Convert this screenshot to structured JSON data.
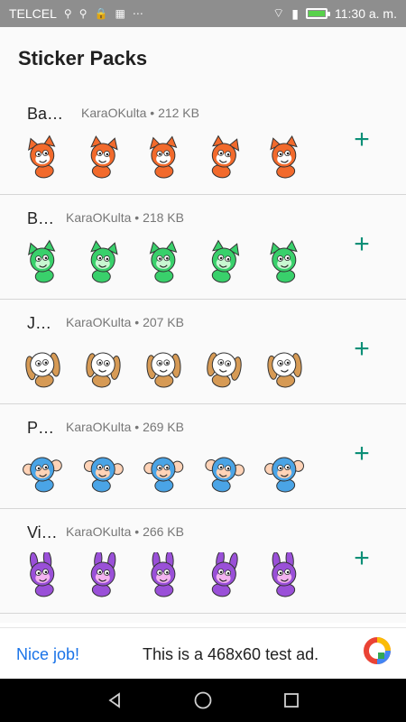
{
  "status_bar": {
    "carrier": "TELCEL",
    "time": "11:30 a. m.",
    "icons": [
      "usb-icon",
      "usb-icon",
      "lock-icon",
      "image-icon",
      "more-icon",
      "wifi-icon",
      "signal-icon",
      "battery-icon"
    ]
  },
  "app_bar": {
    "title": "Sticker Packs"
  },
  "packs": [
    {
      "name": "Ba…",
      "author": "KaraOKulta",
      "size": "212 KB",
      "accent": "#f26a2c",
      "secondary": "#ffffff",
      "character": "fox"
    },
    {
      "name": "B…",
      "author": "KaraOKulta",
      "size": "218 KB",
      "accent": "#39d06b",
      "secondary": "#c8f7d1",
      "character": "cat"
    },
    {
      "name": "J…",
      "author": "KaraOKulta",
      "size": "207 KB",
      "accent": "#d69a55",
      "secondary": "#ffffff",
      "character": "dog"
    },
    {
      "name": "P…",
      "author": "KaraOKulta",
      "size": "269 KB",
      "accent": "#4aa4e6",
      "secondary": "#ffd3b7",
      "character": "monkey"
    },
    {
      "name": "Vi…",
      "author": "KaraOKulta",
      "size": "266 KB",
      "accent": "#9a50d8",
      "secondary": "#f3b3f0",
      "character": "bunny"
    }
  ],
  "ad": {
    "left_text": "Nice job!",
    "center_text": "This is a 468x60 test ad.",
    "logo": "adchoices-logo"
  },
  "nav": {
    "icons": [
      "back-icon",
      "home-icon",
      "recents-icon"
    ]
  },
  "colors": {
    "add_button": "#0c8f77",
    "ad_link": "#1a73e8"
  }
}
